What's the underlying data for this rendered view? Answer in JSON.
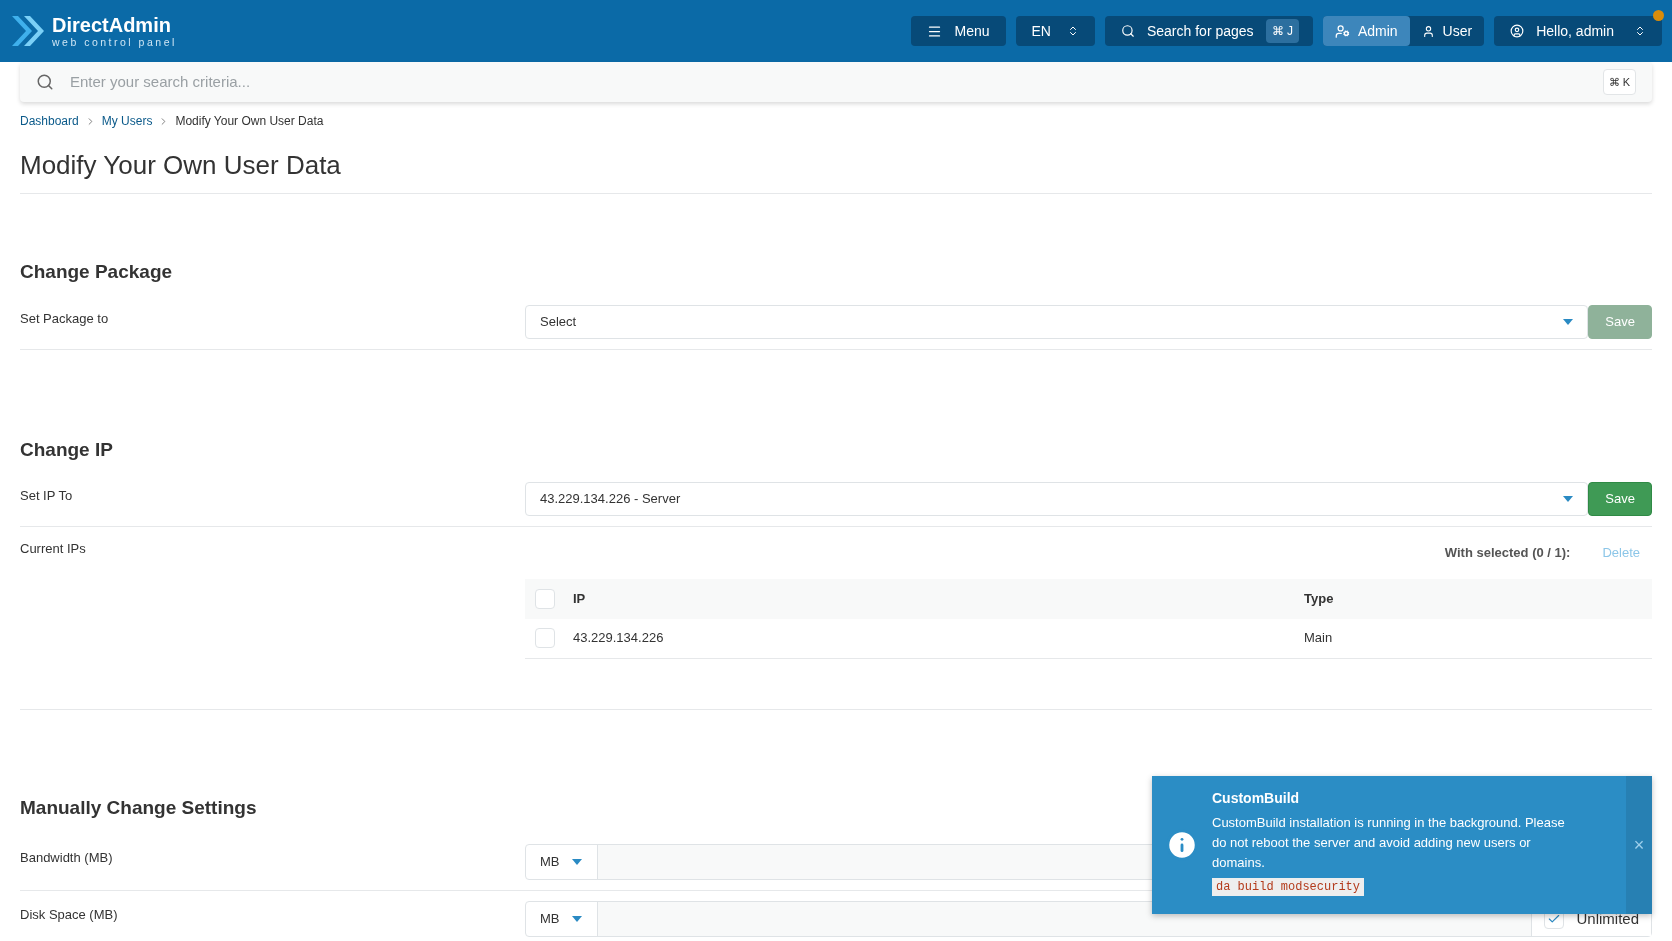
{
  "header": {
    "logo_name": "DirectAdmin",
    "logo_tagline": "web control panel",
    "menu_button": "Menu",
    "language": "EN",
    "page_search": {
      "label": "Search for pages",
      "shortcut": "⌘ J"
    },
    "modes": [
      {
        "label": "Admin",
        "selected": true
      },
      {
        "label": "User",
        "selected": false
      }
    ],
    "user_menu": "Hello, admin",
    "notification_dot": true
  },
  "search": {
    "placeholder": "Enter your search criteria...",
    "shortcut": "⌘ K"
  },
  "breadcrumb": [
    "Dashboard",
    "My Users",
    "Modify Your Own User Data"
  ],
  "title": "Modify Your Own User Data",
  "change_package": {
    "heading": "Change Package",
    "label": "Set Package to",
    "select": "Select",
    "save": {
      "label": "Save",
      "disabled": true
    }
  },
  "change_ip": {
    "heading": "Change IP",
    "label": "Set IP To",
    "select": "43.229.134.226 - Server",
    "save": {
      "label": "Save",
      "disabled": false
    },
    "current_label": "Current IPs",
    "with_selected": "With selected (0 / 1):",
    "delete": "Delete",
    "columns": [
      "IP",
      "Type"
    ],
    "rows": [
      {
        "ip": "43.229.134.226",
        "type": "Main",
        "checked": false
      }
    ],
    "all_checked": false
  },
  "manual": {
    "heading": "Manually Change Settings",
    "rows": [
      {
        "label": "Bandwidth (MB)",
        "unit": "MB"
      },
      {
        "label": "Disk Space (MB)",
        "unit": "MB",
        "unlimited": {
          "label": "Unlimited",
          "checked": true
        }
      }
    ]
  },
  "toast": {
    "title": "CustomBuild",
    "message": "CustomBuild installation is running in the background. Please do not reboot the server and avoid adding new users or domains.",
    "code": "da build modsecurity",
    "close": "×"
  }
}
